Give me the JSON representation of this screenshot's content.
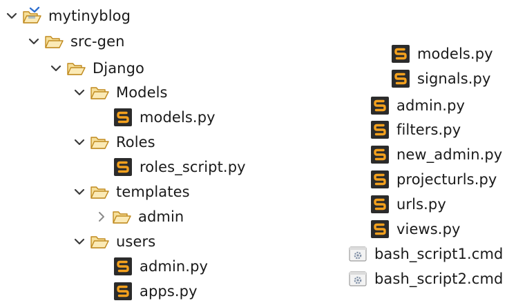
{
  "tree_left": [
    {
      "label": "mytinyblog",
      "kind": "project",
      "expander": "expanded"
    },
    {
      "label": "src-gen",
      "kind": "folder",
      "expander": "expanded"
    },
    {
      "label": "Django",
      "kind": "folder",
      "expander": "expanded"
    },
    {
      "label": "Models",
      "kind": "folder",
      "expander": "expanded"
    },
    {
      "label": "models.py",
      "kind": "python-file",
      "expander": "none"
    },
    {
      "label": "Roles",
      "kind": "folder",
      "expander": "expanded"
    },
    {
      "label": "roles_script.py",
      "kind": "python-file",
      "expander": "none"
    },
    {
      "label": "templates",
      "kind": "folder",
      "expander": "expanded"
    },
    {
      "label": "admin",
      "kind": "folder",
      "expander": "collapsed"
    },
    {
      "label": "users",
      "kind": "folder",
      "expander": "expanded"
    },
    {
      "label": "admin.py",
      "kind": "python-file",
      "expander": "none"
    },
    {
      "label": "apps.py",
      "kind": "python-file",
      "expander": "none"
    }
  ],
  "tree_right": [
    {
      "label": "models.py",
      "kind": "python-file"
    },
    {
      "label": "signals.py",
      "kind": "python-file"
    },
    {
      "label": "admin.py",
      "kind": "python-file"
    },
    {
      "label": "filters.py",
      "kind": "python-file"
    },
    {
      "label": "new_admin.py",
      "kind": "python-file"
    },
    {
      "label": "projecturls.py",
      "kind": "python-file"
    },
    {
      "label": "urls.py",
      "kind": "python-file"
    },
    {
      "label": "views.py",
      "kind": "python-file"
    },
    {
      "label": "bash_script1.cmd",
      "kind": "cmd-file"
    },
    {
      "label": "bash_script2.cmd",
      "kind": "cmd-file"
    }
  ],
  "colors": {
    "folder_fill": "#f6df9a",
    "folder_stroke": "#c08a1e",
    "python_bg": "#2b2b2b",
    "python_s": "#f4a11d",
    "project_blue": "#2f6fcf",
    "chevron": "#3a3a3a",
    "chevron_collapsed": "#8a8a8a"
  }
}
